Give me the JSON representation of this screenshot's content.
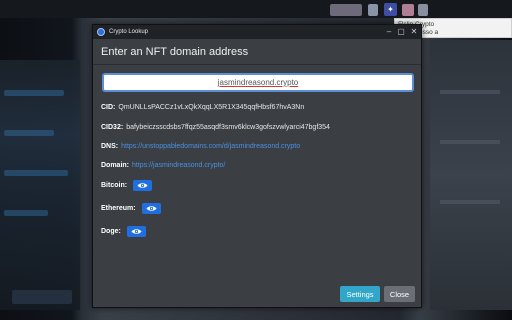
{
  "window": {
    "title": "Crypto Lookup",
    "heading": "Enter an NFT domain address"
  },
  "search": {
    "value": "jasmindreasond.crypto"
  },
  "fields": {
    "cid_label": "CID:",
    "cid_value": "QmUNLLsPACCz1vLxQkXqqLX5R1X345qqfHbsf67hvA3Nn",
    "cid32_label": "CID32:",
    "cid32_value": "bafybeiczsscdsbs7ffqz55asqdf3smv6klcw3gofszvwlyarci47bgf354",
    "dns_label": "DNS:",
    "dns_value": "https://unstoppabledomains.com/d/jasmindreasond.crypto",
    "domain_label": "Domain:",
    "domain_value": "https://jasmindreasond.crypto/",
    "bitcoin_label": "Bitcoin:",
    "ethereum_label": "Ethereum:",
    "doge_label": "Doge:"
  },
  "footer": {
    "settings_label": "Settings",
    "close_label": "Close"
  },
  "tooltip": {
    "line1": "Flclip Crypto",
    "line2": "Tem acesso a"
  },
  "icons": {
    "app": "app-logo-icon",
    "eye": "eye-icon",
    "extension": "extension-icon"
  },
  "colors": {
    "window_bg": "#3b3f44",
    "titlebar_bg": "#1f2226",
    "link": "#4a90e2",
    "primary_button": "#1f6fe0",
    "settings_button": "#31a6c9",
    "close_button": "#6b6f75"
  }
}
